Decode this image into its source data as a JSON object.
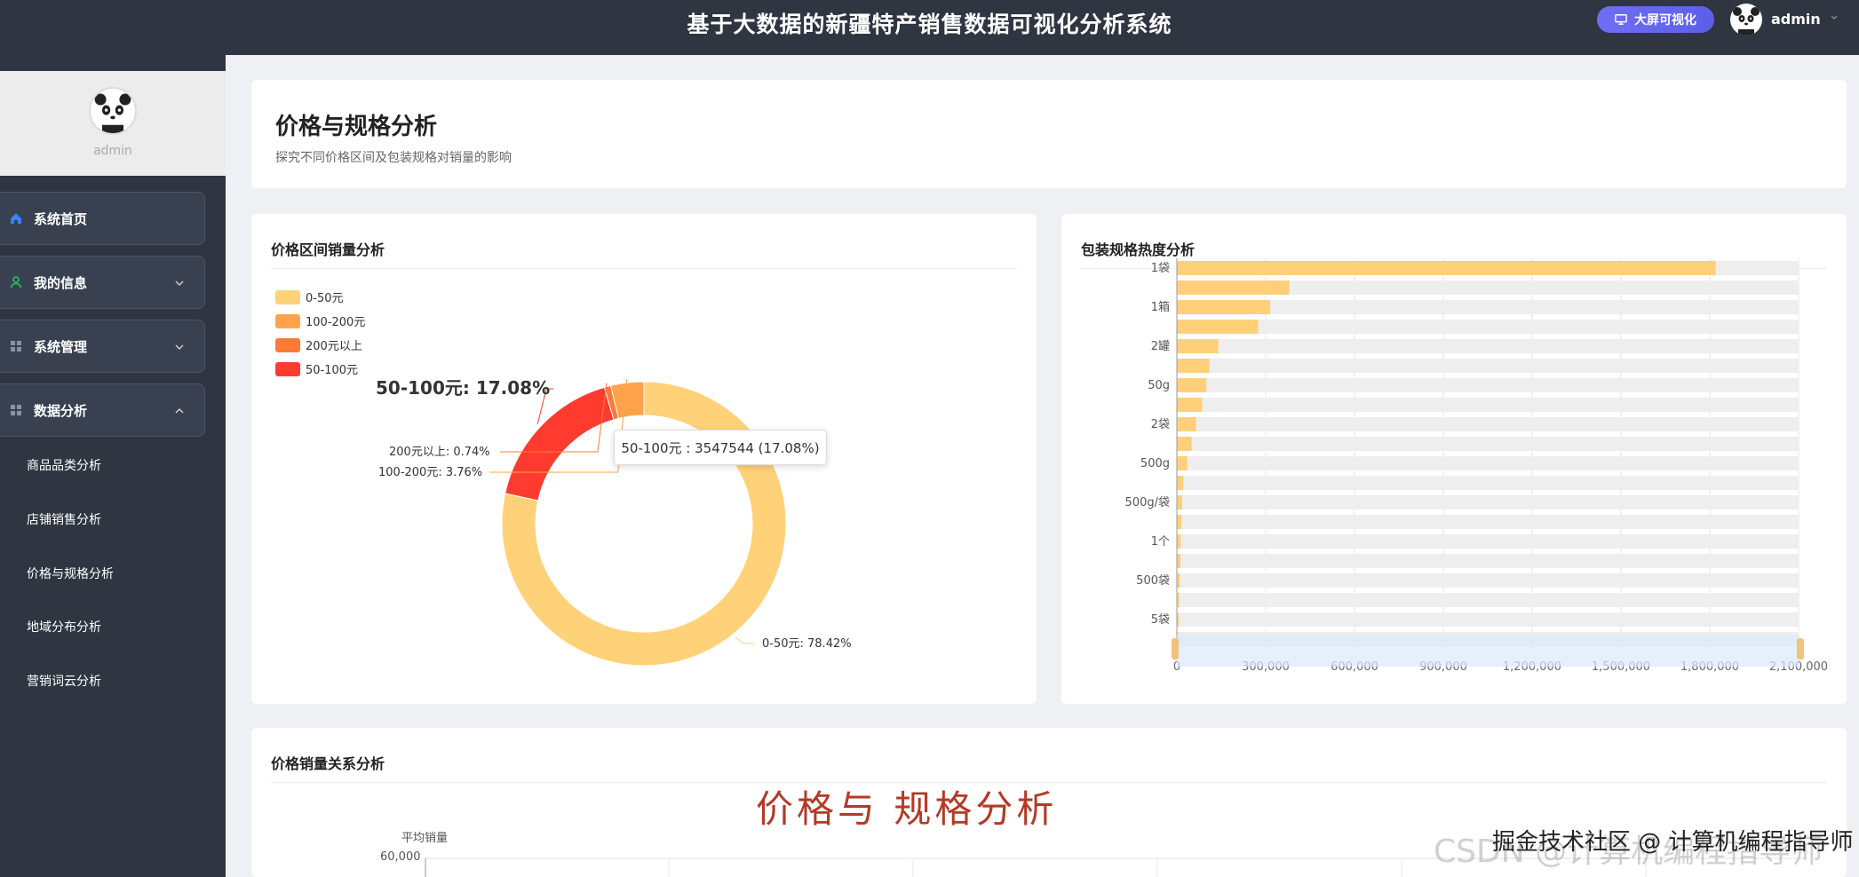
{
  "header": {
    "title": "基于大数据的新疆特产销售数据可视化分析系统",
    "bigscreen_label": "大屏可视化",
    "username": "admin"
  },
  "sidebar": {
    "profile_name": "admin",
    "menu": [
      {
        "label": "系统首页",
        "icon": "home-icon"
      },
      {
        "label": "我的信息",
        "icon": "user-icon"
      },
      {
        "label": "系统管理",
        "icon": "grid-icon"
      },
      {
        "label": "数据分析",
        "icon": "grid-icon"
      }
    ],
    "submenu": [
      "商品品类分析",
      "店铺销售分析",
      "价格与规格分析",
      "地域分布分析",
      "营销词云分析"
    ]
  },
  "page": {
    "title": "价格与规格分析",
    "subtitle": "探究不同价格区间及包装规格对销量的影响"
  },
  "cards": {
    "price_range": "价格区间销量分析",
    "package_spec": "包装规格热度分析",
    "price_sales": "价格销量关系分析"
  },
  "tooltip": "50-100元 : 3547544 (17.08%)",
  "overlay_title": "价格与 规格分析",
  "watermark": "掘金技术社区 @ 计算机编程指导师",
  "watermark_bg": "CSDN @计算机编程指导师",
  "colors": {
    "sidebar": "#2f3541",
    "accent": "#6f6ef5",
    "pie": [
      "#ffd27a",
      "#ffa24a",
      "#ff7a35",
      "#ff3b30"
    ]
  },
  "chart_data": [
    {
      "type": "pie",
      "legend": [
        "0-50元",
        "100-200元",
        "200元以上",
        "50-100元"
      ],
      "legend_position": "top-left",
      "slices": [
        {
          "name": "0-50元",
          "value": 78.42,
          "label": "0-50元: 78.42%"
        },
        {
          "name": "50-100元",
          "value": 17.08,
          "label": "50-100元: 17.08%"
        },
        {
          "name": "200元以上",
          "value": 0.74,
          "label": "200元以上: 0.74%"
        },
        {
          "name": "100-200元",
          "value": 3.76,
          "label": "100-200元: 3.76%"
        }
      ]
    },
    {
      "type": "bar",
      "orientation": "horizontal",
      "y_tick_labels": [
        "1袋",
        "1箱",
        "2罐",
        "50g",
        "2袋",
        "500g",
        "500g/袋",
        "1个",
        "500袋",
        "5袋"
      ],
      "x_tick_labels": [
        "0",
        "300,000",
        "600,000",
        "900,000",
        "1,200,000",
        "1,500,000",
        "1,800,000",
        "2,100,000"
      ],
      "xlim": [
        0,
        2100000
      ],
      "values": [
        1820000,
        380000,
        315000,
        275000,
        140000,
        110000,
        100000,
        85000,
        65000,
        50000,
        35000,
        22000,
        18000,
        15000,
        13000,
        12000,
        10000,
        8000,
        6000,
        5000
      ],
      "grid": true
    },
    {
      "type": "line",
      "ylabel": "平均销量",
      "y_tick_labels": [
        "60,000"
      ]
    }
  ]
}
